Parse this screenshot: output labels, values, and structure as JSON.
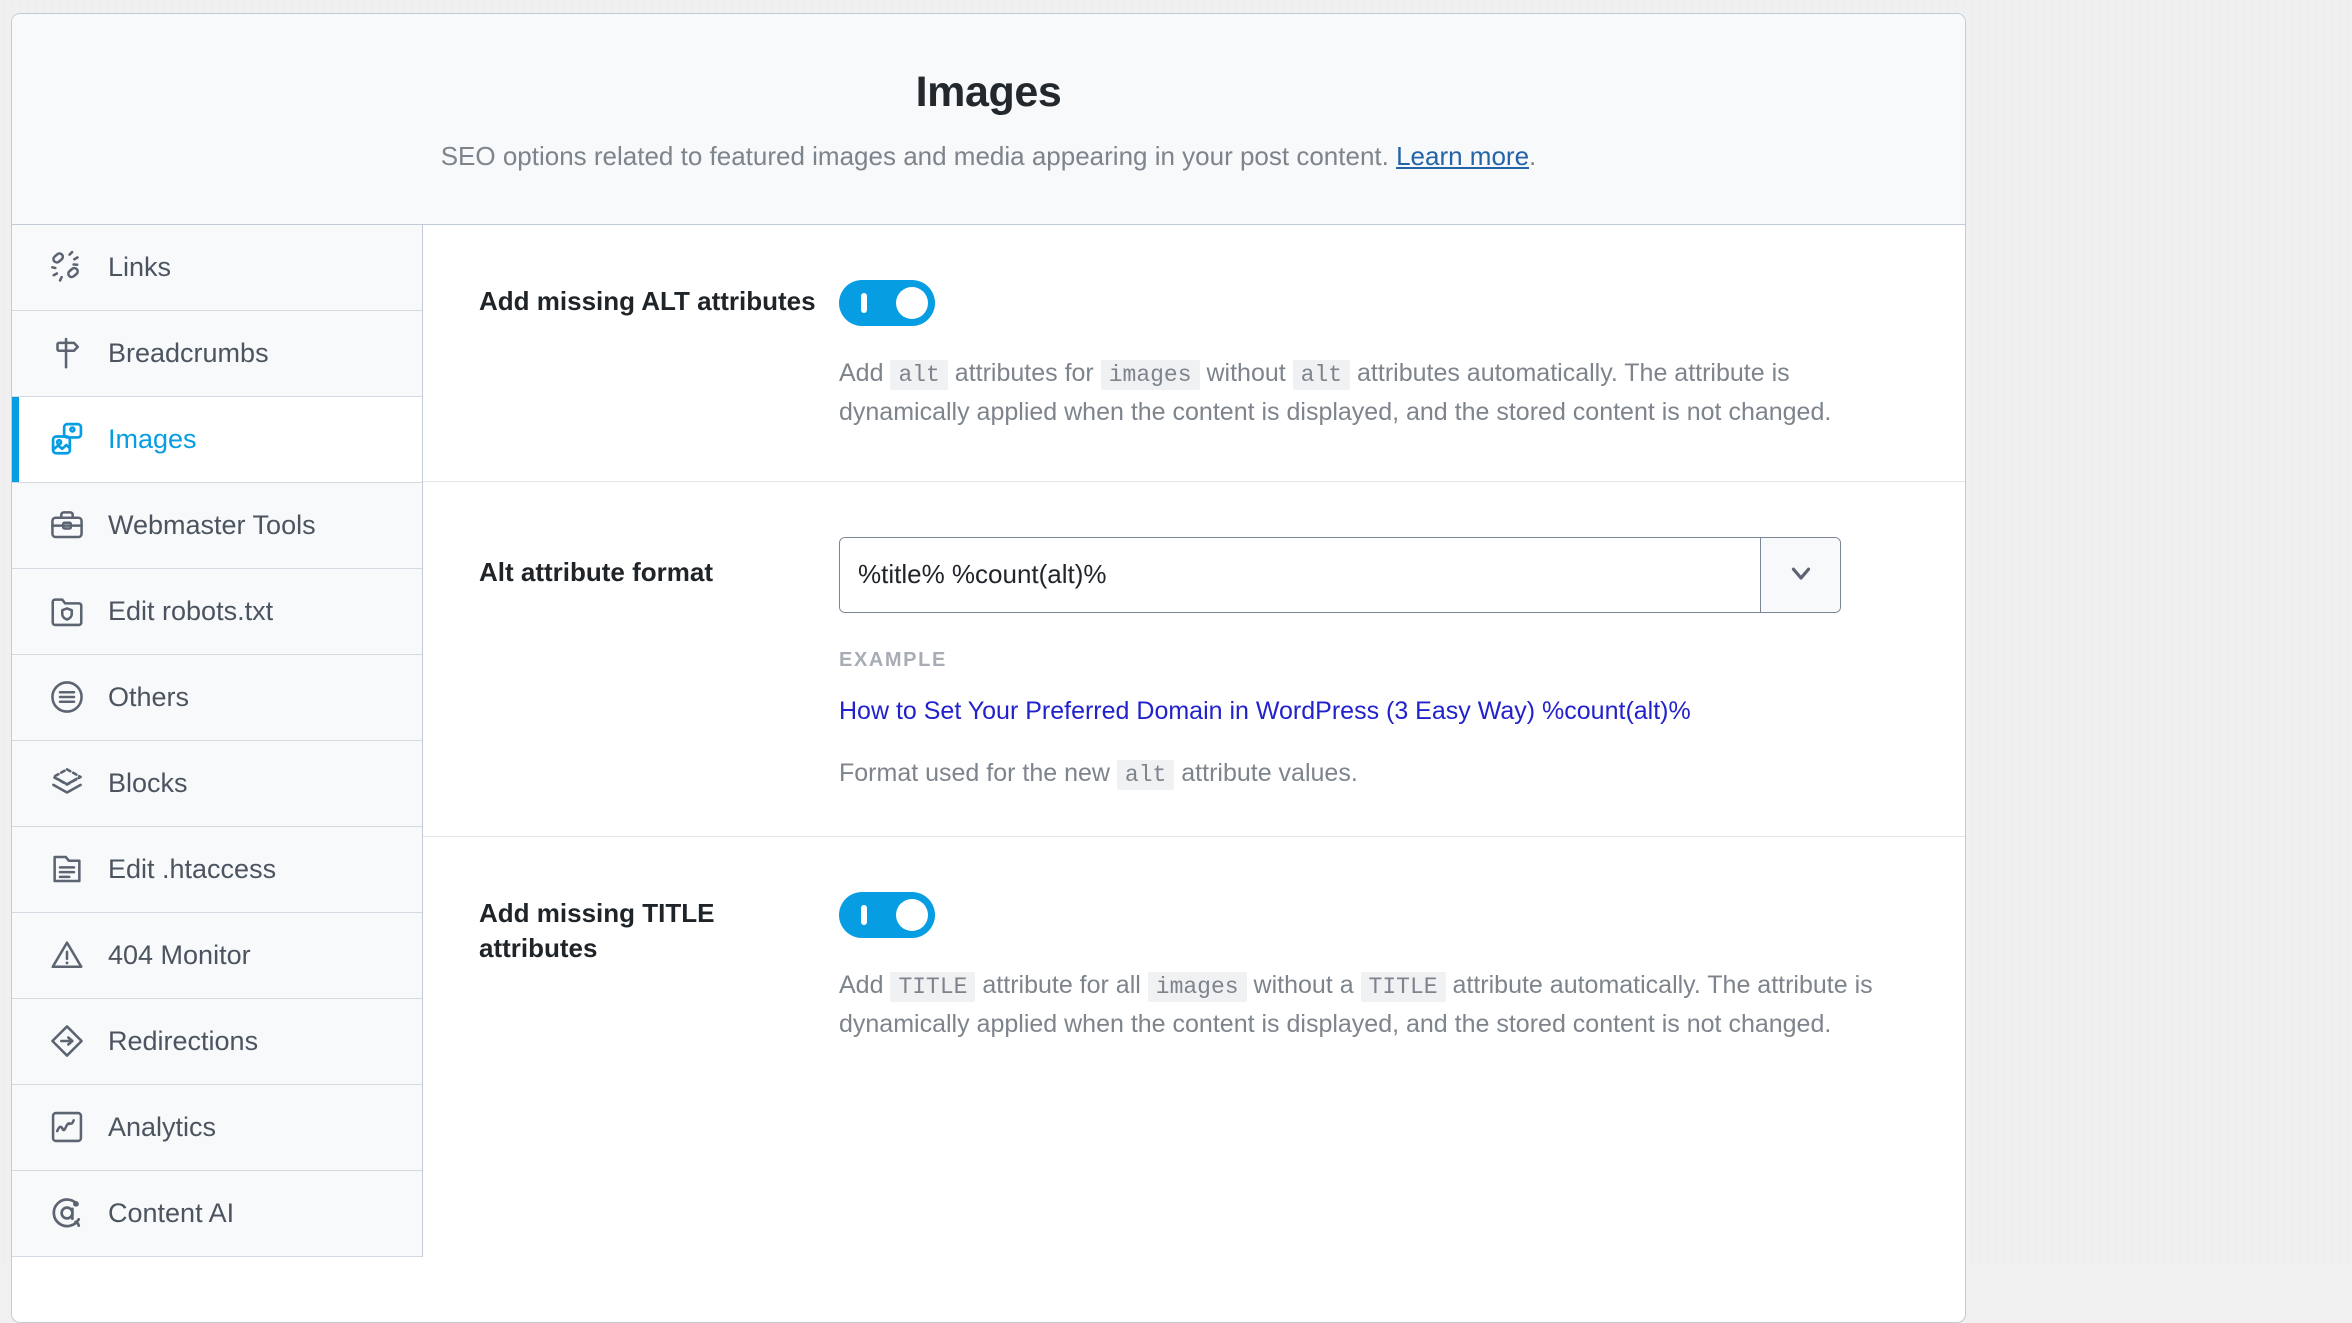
{
  "header": {
    "title": "Images",
    "subtitle_before": "SEO options related to featured images and media appearing in your post content. ",
    "link_label": "Learn more",
    "subtitle_after": "."
  },
  "sidebar": {
    "items": [
      {
        "label": "Links",
        "icon": "links-icon",
        "active": false
      },
      {
        "label": "Breadcrumbs",
        "icon": "signpost-icon",
        "active": false
      },
      {
        "label": "Images",
        "icon": "images-icon",
        "active": true
      },
      {
        "label": "Webmaster Tools",
        "icon": "toolbox-icon",
        "active": false
      },
      {
        "label": "Edit robots.txt",
        "icon": "folder-shield-icon",
        "active": false
      },
      {
        "label": "Others",
        "icon": "list-circle-icon",
        "active": false
      },
      {
        "label": "Blocks",
        "icon": "layers-icon",
        "active": false
      },
      {
        "label": "Edit .htaccess",
        "icon": "file-lines-icon",
        "active": false
      },
      {
        "label": "404 Monitor",
        "icon": "warning-triangle-icon",
        "active": false
      },
      {
        "label": "Redirections",
        "icon": "diamond-arrow-icon",
        "active": false
      },
      {
        "label": "Analytics",
        "icon": "chart-square-icon",
        "active": false
      },
      {
        "label": "Content AI",
        "icon": "content-ai-icon",
        "active": false
      }
    ]
  },
  "settings": {
    "alt_toggle": {
      "label": "Add missing ALT attributes",
      "enabled": true,
      "desc_parts": [
        {
          "t": "Add ",
          "code": false
        },
        {
          "t": "alt",
          "code": true
        },
        {
          "t": " attributes for ",
          "code": false
        },
        {
          "t": "images",
          "code": true
        },
        {
          "t": " without ",
          "code": false
        },
        {
          "t": "alt",
          "code": true
        },
        {
          "t": " attributes automatically. The attribute is dynamically applied when the content is displayed, and the stored content is not changed.",
          "code": false
        }
      ]
    },
    "alt_format": {
      "label": "Alt attribute format",
      "value": "%title% %count(alt)%",
      "placeholder": "",
      "dropdown_icon": "chevron-down-icon",
      "example_label": "EXAMPLE",
      "example_value": "How to Set Your Preferred Domain in WordPress (3 Easy Way) %count(alt)%",
      "note_parts": [
        {
          "t": "Format used for the new ",
          "code": false
        },
        {
          "t": "alt",
          "code": true
        },
        {
          "t": " attribute values.",
          "code": false
        }
      ]
    },
    "title_toggle": {
      "label": "Add missing TITLE attributes",
      "enabled": true,
      "desc_parts": [
        {
          "t": "Add ",
          "code": false
        },
        {
          "t": "TITLE",
          "code": true
        },
        {
          "t": " attribute for all ",
          "code": false
        },
        {
          "t": "images",
          "code": true
        },
        {
          "t": " without a ",
          "code": false
        },
        {
          "t": "TITLE",
          "code": true
        },
        {
          "t": " attribute automatically. The attribute is dynamically applied when the content is displayed, and the stored content is not changed.",
          "code": false
        }
      ]
    }
  },
  "colors": {
    "accent": "#069de3",
    "link": "#2563a8",
    "example_link": "#2222cc",
    "text_muted": "#7d848c"
  }
}
